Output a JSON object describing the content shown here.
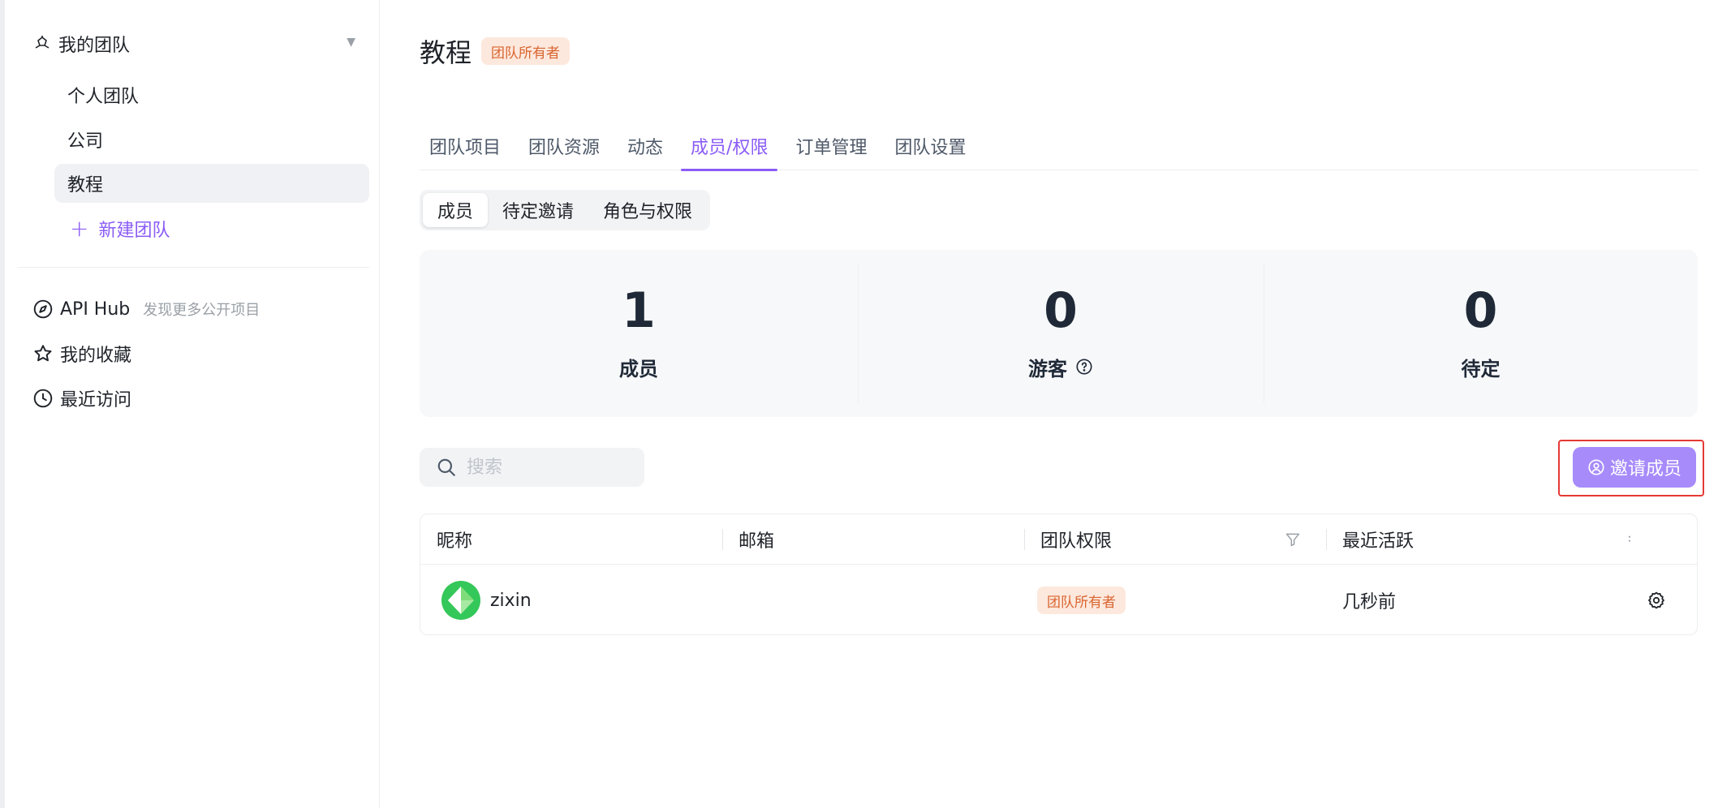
{
  "sidebar": {
    "team_header": "我的团队",
    "teams": [
      {
        "label": "个人团队"
      },
      {
        "label": "公司"
      },
      {
        "label": "教程"
      }
    ],
    "new_team": "新建团队",
    "api_hub": {
      "label": "API Hub",
      "sub": "发现更多公开项目"
    },
    "favorites": "我的收藏",
    "recent": "最近访问"
  },
  "main": {
    "title": "教程",
    "role_badge": "团队所有者",
    "tabs": [
      {
        "label": "团队项目"
      },
      {
        "label": "团队资源"
      },
      {
        "label": "动态"
      },
      {
        "label": "成员/权限"
      },
      {
        "label": "订单管理"
      },
      {
        "label": "团队设置"
      }
    ],
    "segments": [
      {
        "label": "成员"
      },
      {
        "label": "待定邀请"
      },
      {
        "label": "角色与权限"
      }
    ],
    "stats": [
      {
        "value": "1",
        "label": "成员"
      },
      {
        "value": "0",
        "label": "游客"
      },
      {
        "value": "0",
        "label": "待定"
      }
    ],
    "search": {
      "placeholder": "搜索"
    },
    "invite_button": "邀请成员",
    "table": {
      "columns": [
        "昵称",
        "邮箱",
        "团队权限",
        "最近活跃"
      ],
      "rows": [
        {
          "nickname": "zixin",
          "email": "",
          "role": "团队所有者",
          "last_active": "几秒前"
        }
      ]
    }
  },
  "colors": {
    "accent": "#8b5cf6",
    "accent_button": "#a78bfa",
    "owner_badge_bg": "#fde8dd",
    "owner_badge_text": "#d9652f",
    "highlight_frame": "#e53935"
  }
}
